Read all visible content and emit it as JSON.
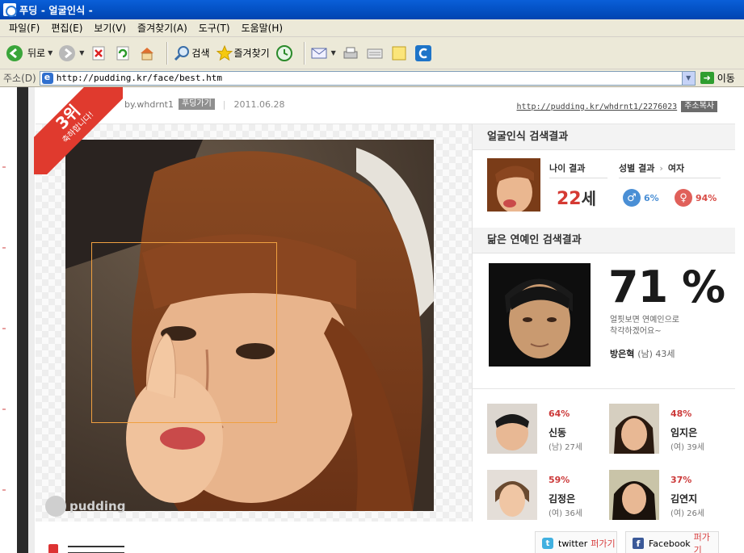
{
  "window": {
    "title": "푸딩 - 얼굴인식 -"
  },
  "menu": [
    "파일(F)",
    "편집(E)",
    "보기(V)",
    "즐겨찾기(A)",
    "도구(T)",
    "도움말(H)"
  ],
  "toolbar": {
    "back_label": "뒤로",
    "search_label": "검색",
    "favorites_label": "즐겨찾기"
  },
  "address": {
    "label": "주소(D)",
    "url": "http://pudding.kr/face/best.htm",
    "go_label": "이동"
  },
  "post": {
    "rank": "3위",
    "congrats": "축하합니다!",
    "author": "by.whdrnt1",
    "tag": "푸딩가기",
    "date": "2011.06.28",
    "short_url": "http://pudding.kr/whdrnt1/2276023",
    "copy_label": "주소복사"
  },
  "result": {
    "title": "얼굴인식 검색결과",
    "age_label": "나이 결과",
    "age_value": "22",
    "age_unit": "세",
    "gender_label": "성별 결과",
    "gender_result": "여자",
    "male_pct": "6%",
    "female_pct": "94%"
  },
  "celebrity": {
    "title": "닮은 연예인 검색결과",
    "main_pct": "71 %",
    "desc_line1": "얼핏보면 연예인으로",
    "desc_line2": "착각하겠어요~",
    "main_name": "방은혁",
    "main_meta": "(남) 43세",
    "others": [
      {
        "pct": "64%",
        "name": "신동",
        "meta": "(남) 27세"
      },
      {
        "pct": "48%",
        "name": "임지은",
        "meta": "(여) 39세"
      },
      {
        "pct": "59%",
        "name": "김정은",
        "meta": "(여) 36세"
      },
      {
        "pct": "37%",
        "name": "김연지",
        "meta": "(여) 26세"
      }
    ]
  },
  "share": {
    "twitter": "twitter",
    "facebook": "Facebook",
    "action": "퍼가기"
  },
  "logo_text": "pudding"
}
